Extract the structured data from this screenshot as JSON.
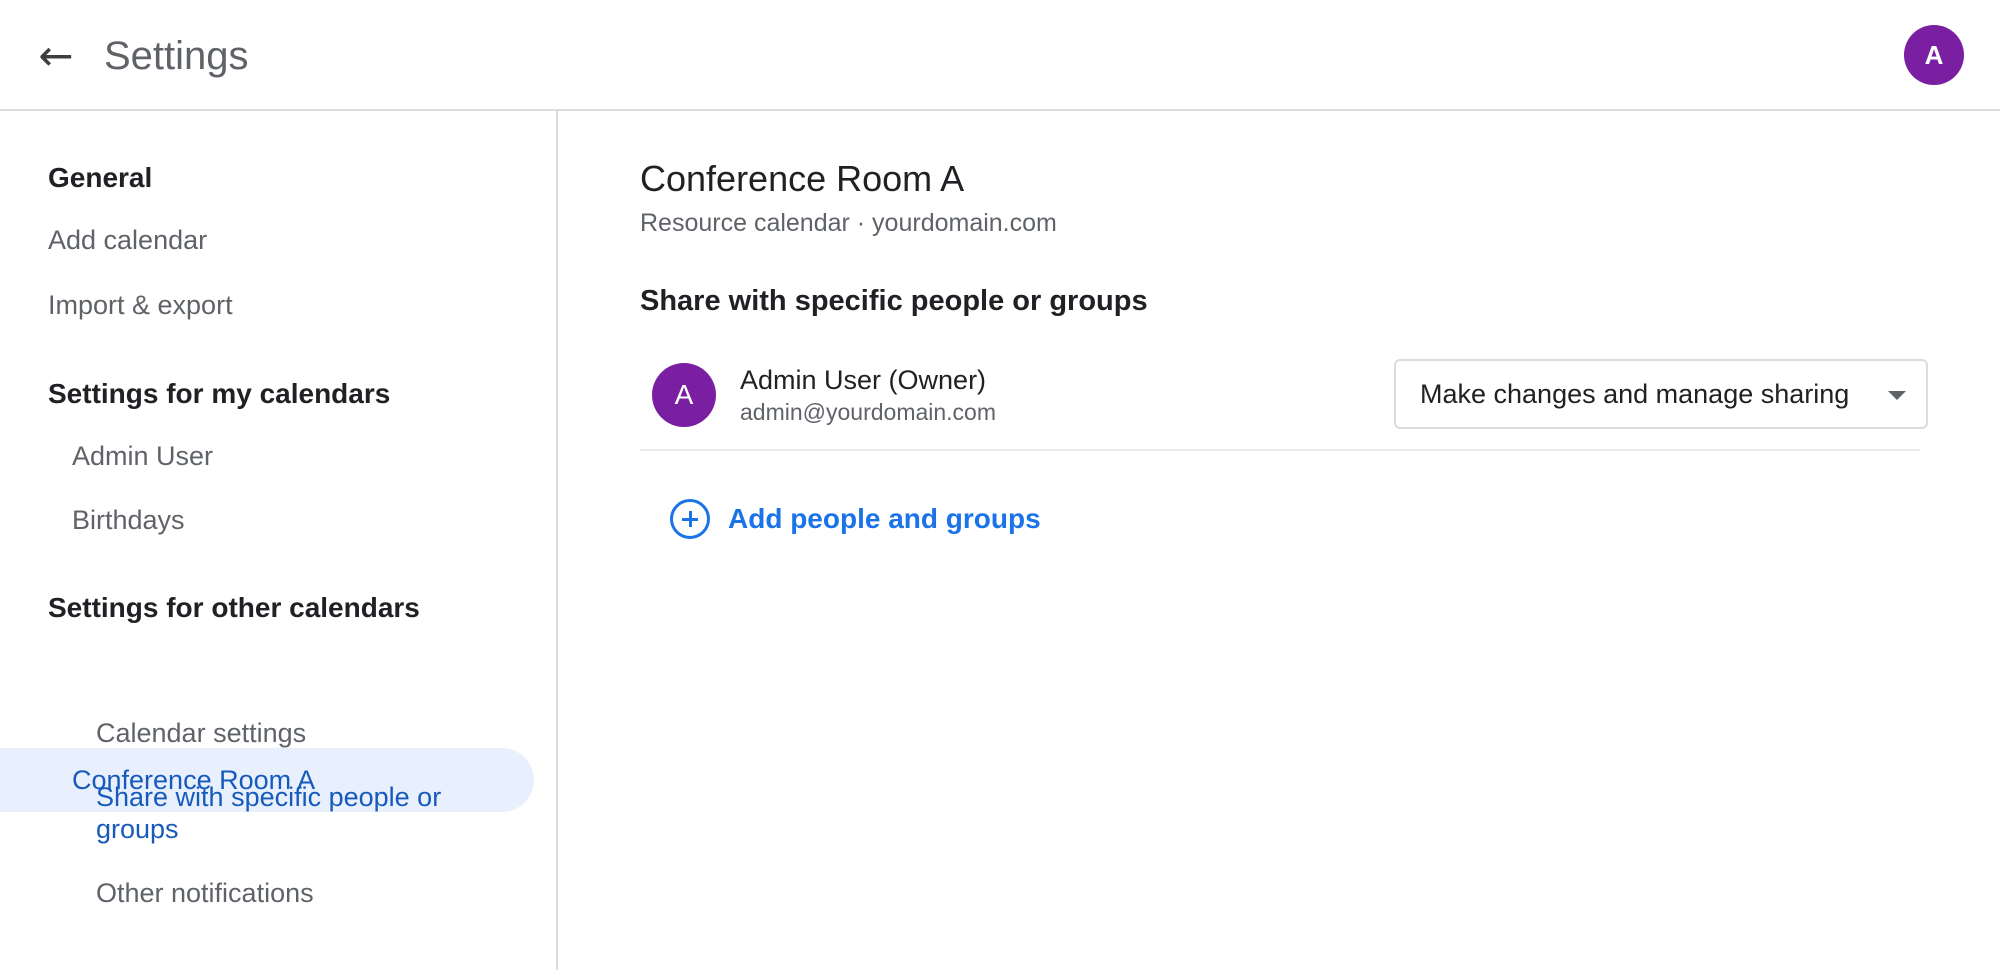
{
  "header": {
    "back_icon": "←",
    "title": "Settings",
    "avatar_initial": "A"
  },
  "sidebar": {
    "general_heading": "General",
    "general_items": [
      "Add calendar",
      "Import & export"
    ],
    "my_calendars_heading": "Settings for my calendars",
    "my_calendars": [
      "Admin User",
      "Birthdays"
    ],
    "other_calendars_heading": "Settings for other calendars",
    "selected_calendar": "Conference Room A",
    "sub_items": [
      "Calendar settings",
      "Share with specific people or groups",
      "Other notifications"
    ]
  },
  "main": {
    "calendar_title": "Conference Room A",
    "calendar_subtitle": "Resource calendar · yourdomain.com",
    "section_title": "Share with specific people or groups",
    "person": {
      "initial": "A",
      "name": "Admin User (Owner)",
      "email": "admin@yourdomain.com",
      "permission": "Make changes and manage sharing"
    },
    "add_people_label": "Add people and groups"
  },
  "colors": {
    "accent": "#1a73e8",
    "active_text": "#185abc",
    "selected_bg": "#e8f0fe",
    "avatar": "#7b1fa2"
  }
}
